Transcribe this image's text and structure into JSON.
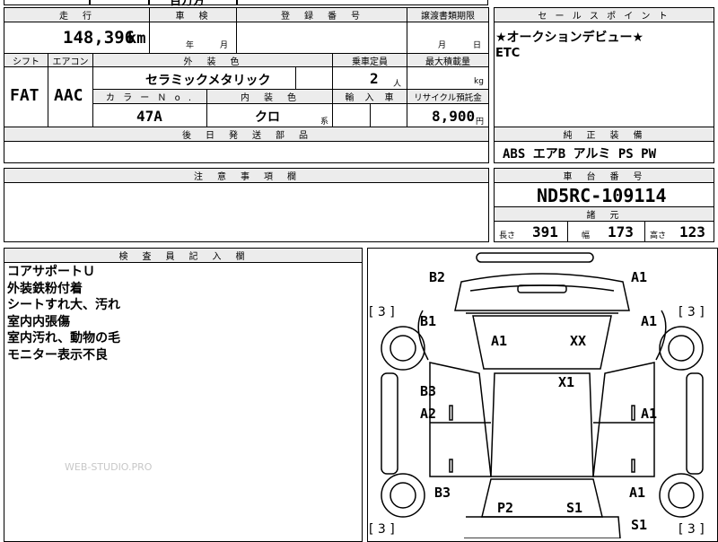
{
  "top_strip": {
    "fragment": "百万方"
  },
  "fields": {
    "mileage_h": "走　行",
    "mileage": "148,396",
    "mileage_unit": "km",
    "inspection_h": "車　検",
    "inspection_year_unit": "年",
    "inspection_month_unit": "月",
    "regnum_h": "登　録　番　号",
    "transfer_h": "譲渡書類期限",
    "transfer_month_unit": "月",
    "transfer_day_unit": "日",
    "shift_h": "シフト",
    "shift": "FAT",
    "ac_h": "エアコン",
    "ac": "AAC",
    "exterior_color_h": "外　装　色",
    "exterior_color": "セラミックメタリック",
    "capacity_h": "乗車定員",
    "capacity": "2",
    "capacity_unit": "人",
    "max_load_h": "最大積載量",
    "max_load_unit": "kg",
    "color_no_h": "カ ラ ー Ｎ o .",
    "color_no": "47A",
    "interior_h": "内　装　色",
    "interior": "クロ",
    "interior_unit": "系",
    "import_h": "輸　入　車",
    "recycle_h": "リサイクル預託金",
    "recycle": "8,900",
    "recycle_unit": "円",
    "after_parts_h": "後　日　発　送　部　品"
  },
  "sales": {
    "header": "セ ー ル ス ポ イ ン ト",
    "line1": "★オークションデビュー★",
    "line2": "ETC"
  },
  "equipment": {
    "header": "純　正　装　備",
    "items": "ABS エアB アルミ PS PW"
  },
  "notes": {
    "header": "注　意　事　項　欄"
  },
  "chassis": {
    "header": "車　台　番　号",
    "value": "ND5RC-109114"
  },
  "specs": {
    "header": "諸　元",
    "length_label": "長さ",
    "length": "391",
    "width_label": "幅",
    "width": "173",
    "height_label": "高さ",
    "height": "123"
  },
  "inspector": {
    "header": "検　査　員　記　入　欄",
    "lines": [
      "コアサポートＵ",
      "外装鉄粉付着",
      "シートすれ大、汚れ",
      "室内内張傷",
      "室内汚れ、動物の毛",
      "モニター表示不良"
    ]
  },
  "watermark": "WEB-STUDIO.PRO",
  "diagram": {
    "marks": {
      "b2": "B2",
      "a1_tr": "A1",
      "b1": "B1",
      "a1_r1": "A1",
      "a1_c": "A1",
      "xx": "XX",
      "x1": "X1",
      "b3_l": "B3",
      "a2": "A2",
      "a1_r2": "A1",
      "b3_bl": "B3",
      "a1_br": "A1",
      "p2": "P2",
      "s1_c": "S1",
      "s1_r": "S1"
    },
    "tires": {
      "fl": "[ 3 ]",
      "fr": "[ 3 ]",
      "rl": "[ 3 ]",
      "rr": "[ 3 ]"
    }
  }
}
